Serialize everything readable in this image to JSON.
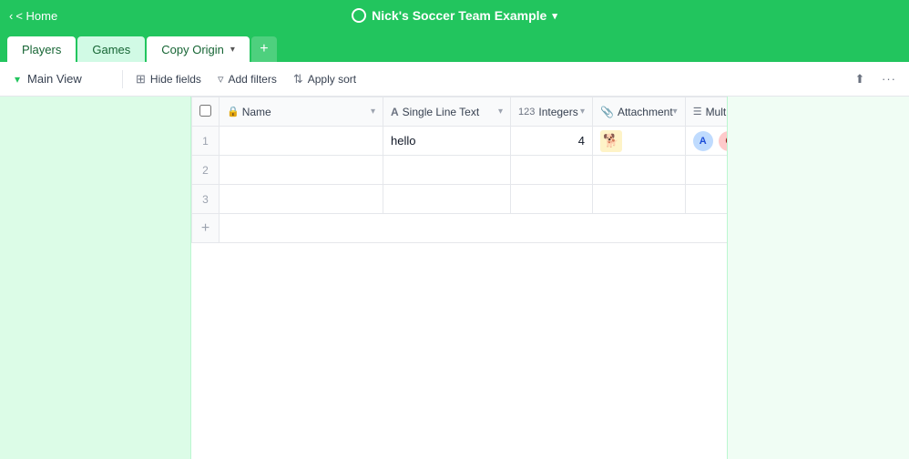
{
  "topBar": {
    "homeLabel": "< Home",
    "titleCircle": "",
    "title": "Nick's Soccer Team Example",
    "titleChevron": "▾"
  },
  "tabs": [
    {
      "label": "Players",
      "active": true
    },
    {
      "label": "Games",
      "active": false
    },
    {
      "label": "Copy Origin",
      "active": false,
      "hasChevron": true
    }
  ],
  "tabAddBtn": "+",
  "toolbar": {
    "viewLabel": "Main View",
    "viewChevron": "▾",
    "hideFields": "Hide fields",
    "addFilters": "Add filters",
    "applySort": "Apply sort",
    "shareIcon": "⬆",
    "moreIcon": "···"
  },
  "table": {
    "columns": [
      {
        "id": "name",
        "icon": "🔒",
        "label": "Name",
        "type": "name"
      },
      {
        "id": "text",
        "icon": "A",
        "label": "Single Line Text",
        "type": "text"
      },
      {
        "id": "int",
        "icon": "#",
        "label": "Integers",
        "type": "int"
      },
      {
        "id": "attach",
        "icon": "📎",
        "label": "Attachment",
        "type": "attach"
      },
      {
        "id": "multi",
        "icon": "☰",
        "label": "Multiple Select",
        "type": "multi"
      },
      {
        "id": "add",
        "icon": "+",
        "label": "",
        "type": "add"
      }
    ],
    "rows": [
      {
        "num": 1,
        "name": "",
        "text": "hello",
        "int": "4",
        "attach": "🐕",
        "tags": [
          "A",
          "C"
        ]
      },
      {
        "num": 2,
        "name": "",
        "text": "",
        "int": "",
        "attach": "",
        "tags": []
      },
      {
        "num": 3,
        "name": "",
        "text": "",
        "int": "",
        "attach": "",
        "tags": []
      }
    ]
  }
}
